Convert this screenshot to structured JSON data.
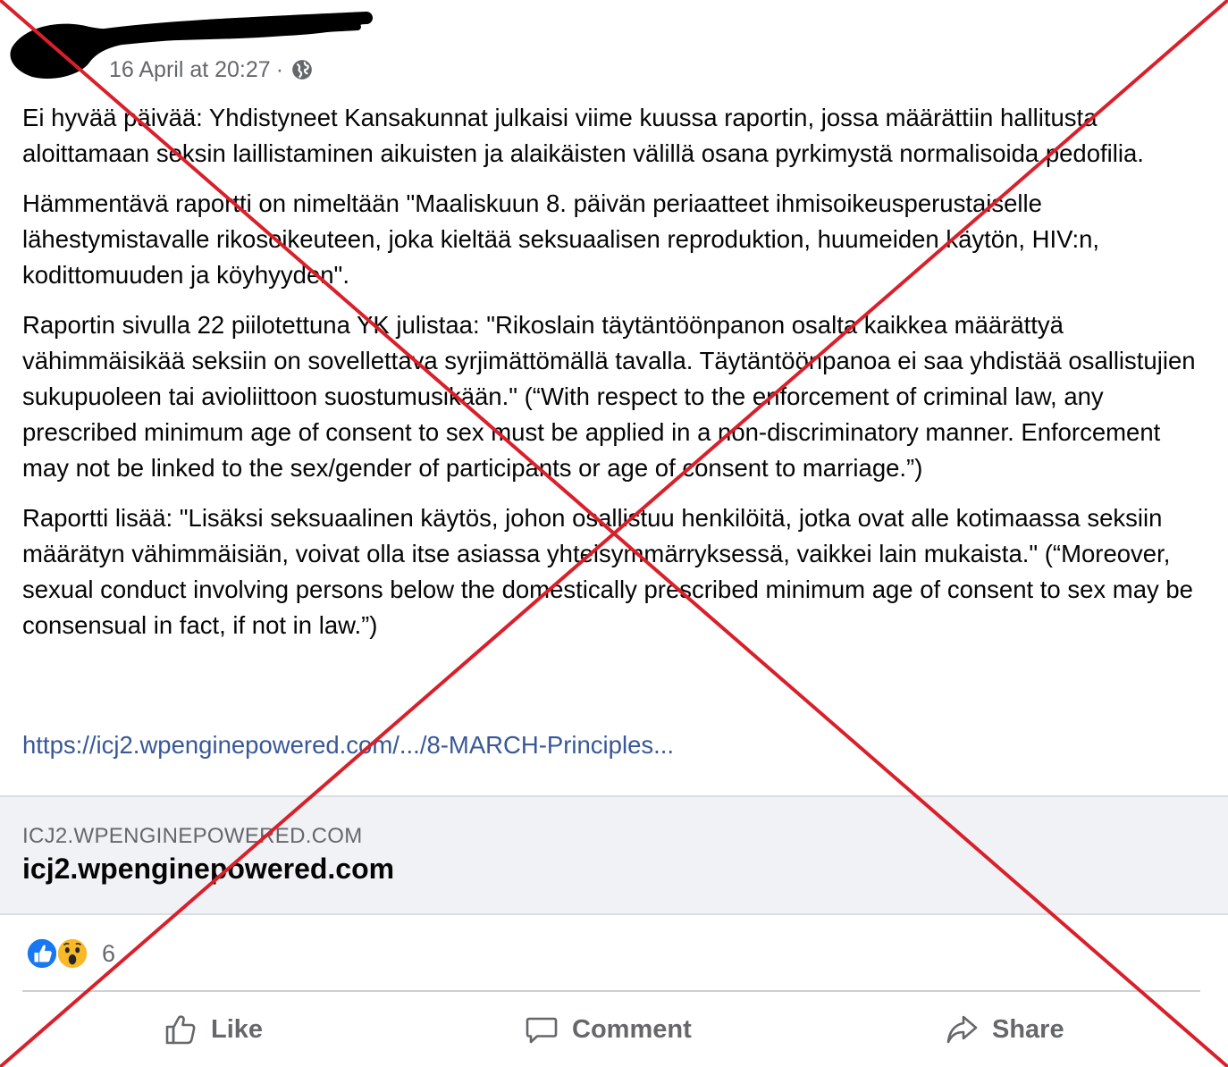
{
  "post": {
    "timestamp": "16 April at 20:27",
    "separator": "·",
    "paragraphs": [
      "Ei hyvää päivää: Yhdistyneet Kansakunnat julkaisi viime kuussa raportin, jossa määrättiin hallitusta aloittamaan seksin laillistaminen aikuisten ja alaikäisten välillä osana pyrkimystä normalisoida pedofilia.",
      "Hämmentävä raportti on nimeltään \"Maaliskuun 8. päivän periaatteet ihmisoikeusperustaiselle lähestymistavalle rikosoikeuteen, joka kieltää seksuaalisen reproduktion, huumeiden käytön, HIV:n, kodittomuuden ja köyhyyden\".",
      "Raportin sivulla 22 piilotettuna YK julistaa: \"Rikoslain täytäntöönpanon osalta kaikkea määrättyä vähimmäisikää seksiin on sovellettava syrjimättömällä tavalla. Täytäntöönpanoa ei saa yhdistää osallistujien sukupuoleen tai avioliittoon suostumusikään.\" (“With respect to the enforcement of criminal law, any prescribed minimum age of consent to sex must be applied in a non-discriminatory manner. Enforcement may not be linked to the sex/gender of participants or age of consent to marriage.”)",
      "Raportti lisää: \"Lisäksi seksuaalinen käytös, johon osallistuu henkilöitä, jotka ovat alle kotimaassa seksiin määrätyn vähimmäisiän, voivat olla itse asiassa yhteisymmärryksessä, vaikkei lain mukaista.\" (“Moreover, sexual conduct involving persons below the domestically prescribed minimum age of consent to sex may be consensual in fact, if not in law.”)"
    ],
    "link_text": "https://icj2.wpenginepowered.com/.../8-MARCH-Principles..."
  },
  "preview": {
    "domain": "ICJ2.WPENGINEPOWERED.COM",
    "title": "icj2.wpenginepowered.com"
  },
  "reactions": {
    "icons": [
      "like-reaction-icon",
      "wow-reaction-icon"
    ],
    "count": "6"
  },
  "actions": {
    "like": "Like",
    "comment": "Comment",
    "share": "Share"
  },
  "colors": {
    "link": "#385898",
    "muted": "#65676b",
    "cross": "#d9202a",
    "like_blue": "#1877f2",
    "wow_yellow": "#f7b928"
  }
}
